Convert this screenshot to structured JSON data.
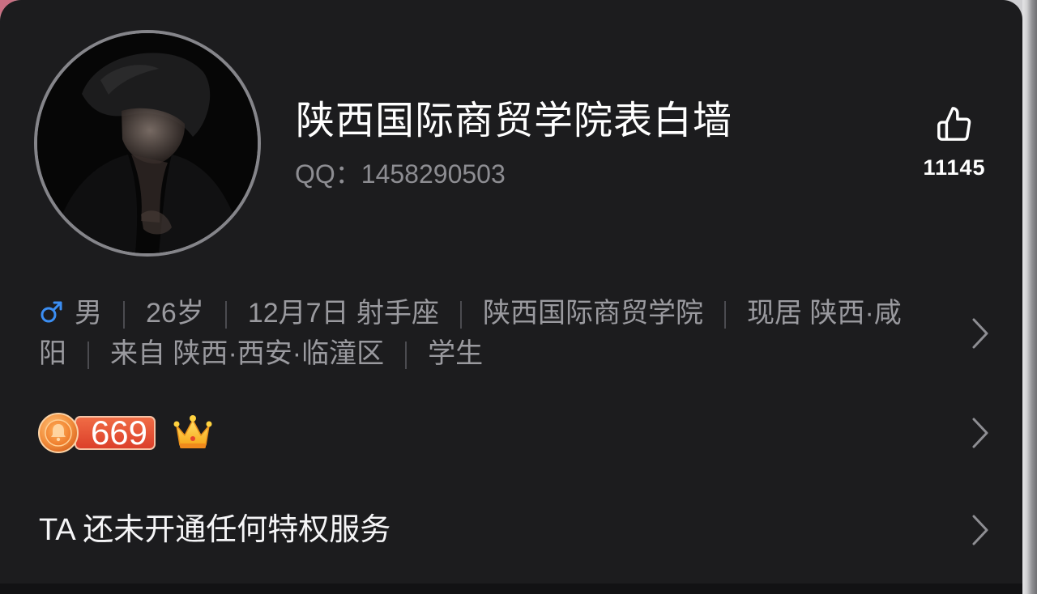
{
  "profile": {
    "name": "陕西国际商贸学院表白墙",
    "qq": "QQ：1458290503",
    "likes": "11145",
    "like_icon": "thumbs-up-icon",
    "details": {
      "gender_icon": "male-icon",
      "gender": "男",
      "items": [
        "26岁",
        "12月7日 射手座",
        "陕西国际商贸学院",
        "现居 陕西·咸阳",
        "来自 陕西·西安·临潼区",
        "学生"
      ]
    }
  },
  "level": {
    "coin_icon": "level-coin-icon",
    "value": "669",
    "badge_icon": "crown-icon"
  },
  "privilege": {
    "text": "TA 还未开通任何特权服务"
  },
  "row_icon": "chevron-right-icon",
  "colors": {
    "background": "#1c1c1e",
    "text_primary": "#ffffff",
    "text_secondary": "#8e8e93",
    "gender_male": "#3b8ef3",
    "level_badge": "#e4502f",
    "crown": "#ffc93c"
  }
}
